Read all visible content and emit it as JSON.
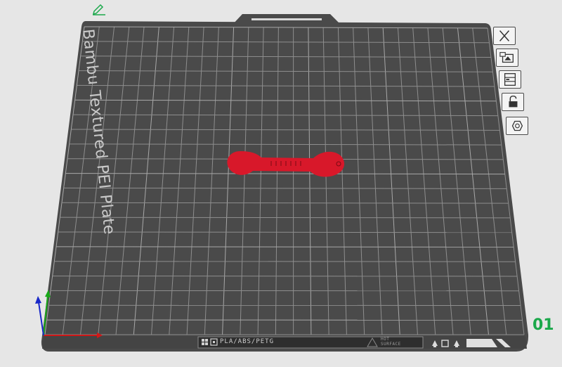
{
  "plate": {
    "name": "Bambu Textured PEI Plate",
    "number": "01",
    "filament_types": "PLA/ABS/PETG",
    "surface_note_line1": "HOT",
    "surface_note_line2": "SURFACE"
  },
  "toolbar": {
    "buttons": [
      {
        "name": "close-plate-button",
        "icon": "close-icon"
      },
      {
        "name": "arrange-button",
        "icon": "arrange-icon"
      },
      {
        "name": "plate-settings-button",
        "icon": "plate-settings-icon"
      },
      {
        "name": "lock-plate-button",
        "icon": "lock-icon"
      },
      {
        "name": "auto-orient-button",
        "icon": "hexagon-icon"
      }
    ]
  },
  "colors": {
    "background": "#e6e6e6",
    "plate": "#4a4a4a",
    "grid": "#8e8e8e",
    "model": "#d8182a",
    "plate_number": "#1aa84a",
    "axis_x": "#d01818",
    "axis_y": "#18a818",
    "axis_z": "#1828c8"
  }
}
